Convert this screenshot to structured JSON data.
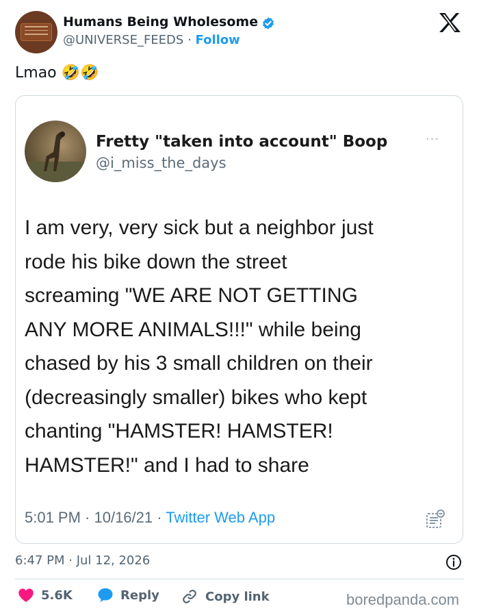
{
  "author": {
    "name": "Humans Being Wholesome",
    "handle": "@UNIVERSE_FEEDS",
    "separator": "·",
    "follow_label": "Follow",
    "verified_icon": "verified-badge-icon",
    "avatar": "plaque-avatar"
  },
  "tweet": {
    "text": "Lmao 🤣🤣",
    "timestamp": "6:47 PM · Jul 12, 2026"
  },
  "embedded": {
    "name": "Fretty \"taken into account\" Boop",
    "handle": "@i_miss_the_days",
    "more_label": "···",
    "body_lines": [
      "I am very, very sick but a neighbor just",
      "rode his bike down the street",
      "screaming \"WE ARE NOT GETTING",
      "ANY MORE ANIMALS!!!\" while being",
      "chased by his 3 small children on their",
      "(decreasingly smaller) bikes who kept",
      "chanting \"HAMSTER! HAMSTER!",
      "HAMSTER!\" and I had to share"
    ],
    "time": "5:01 PM · 10/16/21 ·",
    "source": "Twitter Web App"
  },
  "actions": {
    "likes": "5.6K",
    "reply_label": "Reply",
    "copy_label": "Copy link"
  },
  "watermark": "boredpanda.com",
  "colors": {
    "accent": "#1d9bf0",
    "like": "#f91880",
    "text": "#0f1419",
    "muted": "#536471",
    "border": "#cfd9de"
  }
}
